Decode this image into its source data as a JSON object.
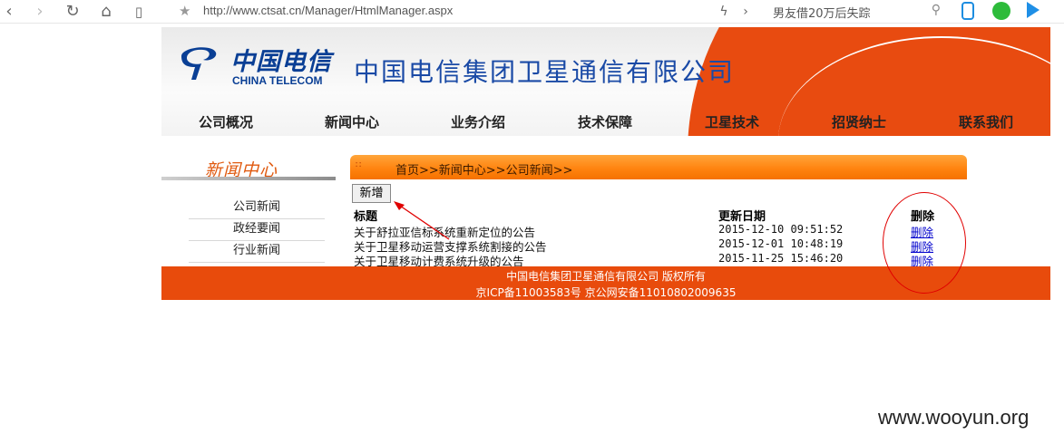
{
  "browser": {
    "url": "http://www.ctsat.cn/Manager/HtmlManager.aspx",
    "search_hint": "男友借20万后失踪"
  },
  "site": {
    "logo_cn": "中国电信",
    "logo_en": "CHINA TELECOM",
    "company_name": "中国电信集团卫星通信有限公司",
    "menu": [
      "公司概况",
      "新闻中心",
      "业务介绍",
      "技术保障",
      "卫星技术",
      "招贤纳士",
      "联系我们"
    ],
    "sidebar_title": "新闻中心",
    "sidebar_items": [
      "公司新闻",
      "政经要闻",
      "行业新闻"
    ],
    "breadcrumb": "首页>>新闻中心>>公司新闻>>",
    "new_button": "新增",
    "columns": {
      "title": "标题",
      "date": "更新日期",
      "delete": "删除"
    },
    "rows": [
      {
        "title": "关于舒拉亚信标系统重新定位的公告",
        "date": "2015-12-10 09:51:52",
        "action": "删除"
      },
      {
        "title": "关于卫星移动运营支撑系统割接的公告",
        "date": "2015-12-01 10:48:19",
        "action": "删除"
      },
      {
        "title": "关于卫星移动计费系统升级的公告",
        "date": "2015-11-25 15:46:20",
        "action": "删除"
      }
    ],
    "footer_line1": "中国电信集团卫星通信有限公司 版权所有",
    "footer_line2": "京ICP备11003583号 京公网安备11010802009635"
  },
  "watermark": "www.wooyun.org",
  "colors": {
    "brand_orange": "#e84b0c",
    "brand_blue": "#0a3f95",
    "annotation_red": "#e00000"
  }
}
